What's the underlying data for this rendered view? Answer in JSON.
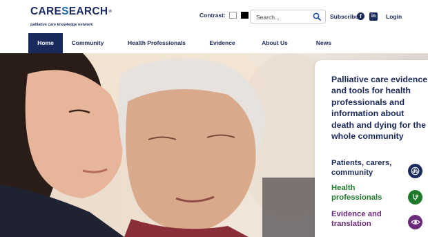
{
  "logo": {
    "care": "CARE",
    "s": "S",
    "earch": "EARCH",
    "reg": "®",
    "tagline": "palliative care knowledge network"
  },
  "header": {
    "contrast_label": "Contrast:",
    "search_placeholder": "Search...",
    "subscribe": "Subscribe",
    "facebook_glyph": "f",
    "linkedin_glyph": "in",
    "login": "Login"
  },
  "nav": {
    "items": [
      {
        "label": "Home",
        "active": true
      },
      {
        "label": "Community"
      },
      {
        "label": "Health Professionals"
      },
      {
        "label": "Evidence"
      },
      {
        "label": "About Us"
      },
      {
        "label": "News"
      }
    ]
  },
  "hero": {
    "headline": "Palliative care evidence and tools for health professionals and information about death and dying for the whole community",
    "links": [
      {
        "label": "Patients, carers, community",
        "color": "#1b2a5c",
        "icon": "community-icon"
      },
      {
        "label": "Health professionals",
        "color": "#1f7a2c",
        "icon": "stethoscope-icon"
      },
      {
        "label": "Evidence and translation",
        "color": "#6b2a7a",
        "icon": "eye-icon"
      }
    ]
  },
  "colors": {
    "navy": "#1b2a5c",
    "accent_blue": "#1b6ab2"
  }
}
